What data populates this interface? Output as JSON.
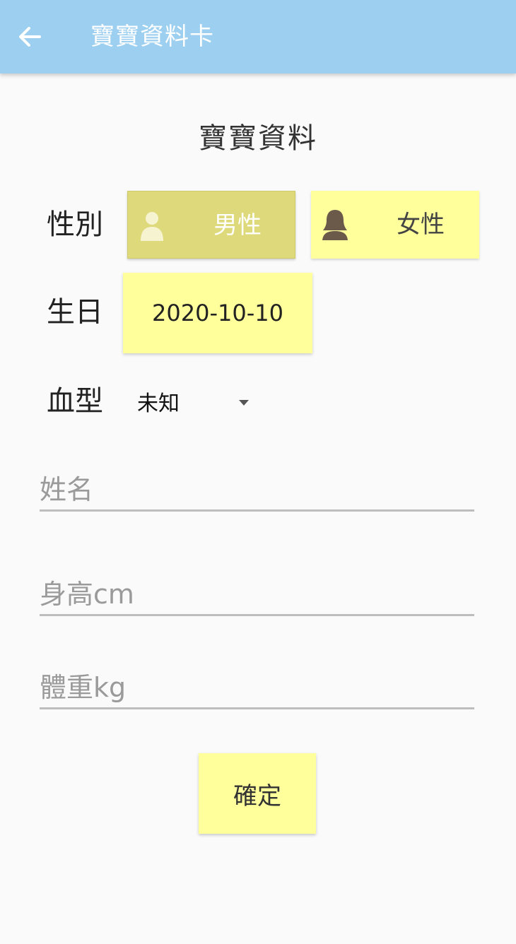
{
  "appbar": {
    "title": "寶寶資料卡",
    "back_icon": "arrow-left-icon",
    "color": "#9ccff0"
  },
  "form": {
    "section_title": "寶寶資料",
    "gender": {
      "label": "性別",
      "male_label": "男性",
      "female_label": "女性",
      "male_icon": "person-icon",
      "female_icon": "woman-icon",
      "selected": "男性"
    },
    "birthday": {
      "label": "生日",
      "value": "2020-10-10"
    },
    "blood_type": {
      "label": "血型",
      "selected": "未知"
    },
    "name_field": {
      "placeholder": "姓名",
      "value": ""
    },
    "height_field": {
      "placeholder": "身高cm",
      "value": ""
    },
    "weight_field": {
      "placeholder": "體重kg",
      "value": ""
    },
    "confirm_label": "確定"
  },
  "colors": {
    "button_yellow": "#ffff9c",
    "selected_yellow": "#ded97a"
  }
}
